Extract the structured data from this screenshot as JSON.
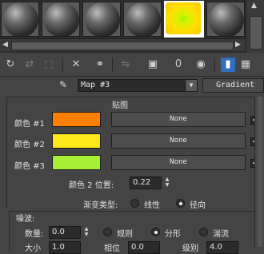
{
  "slots": [
    {
      "name": "sample-slot-1",
      "active": false
    },
    {
      "name": "sample-slot-2",
      "active": false
    },
    {
      "name": "sample-slot-3",
      "active": false
    },
    {
      "name": "sample-slot-4",
      "active": false
    },
    {
      "name": "sample-slot-5",
      "active": true
    },
    {
      "name": "sample-slot-6",
      "active": false
    }
  ],
  "toolbar": {
    "icons": [
      "get-material-icon",
      "put-to-scene-icon",
      "assign-to-selection-icon",
      "reset-map-icon",
      "make-unique-icon",
      "put-to-library-icon",
      "material-id-icon",
      "show-map-icon",
      "show-end-result-icon",
      "go-to-parent-icon",
      "go-forward-to-sibling-icon"
    ],
    "material_id_label": "0"
  },
  "map": {
    "name": "Map #3",
    "type_label": "Gradient"
  },
  "panel": {
    "title": "贴图",
    "colors": [
      {
        "label": "颜色 #1",
        "hex": "#ff8000",
        "map_label": "None",
        "checked": true
      },
      {
        "label": "颜色 #2",
        "hex": "#ffe81a",
        "map_label": "None",
        "checked": true
      },
      {
        "label": "颜色 #3",
        "hex": "#a6ef34",
        "map_label": "None",
        "checked": true
      }
    ],
    "color2_position_label": "颜色 2 位置:",
    "color2_position_value": "0.22",
    "gradient_type_label": "渐变类型:",
    "gradient_types": [
      {
        "label": "线性",
        "selected": false
      },
      {
        "label": "径向",
        "selected": true
      }
    ]
  },
  "noise": {
    "group_label": "噪波:",
    "amount_label": "数量:",
    "amount_value": "0.0",
    "types": [
      {
        "label": "规则",
        "selected": false
      },
      {
        "label": "分形",
        "selected": true
      },
      {
        "label": "湍流",
        "selected": false
      }
    ],
    "row2": {
      "size_label": "大小",
      "size_value": "1.0",
      "phase_label": "相位",
      "phase_value": "0.0",
      "levels_label": "级别",
      "levels_value": "4.0"
    }
  }
}
